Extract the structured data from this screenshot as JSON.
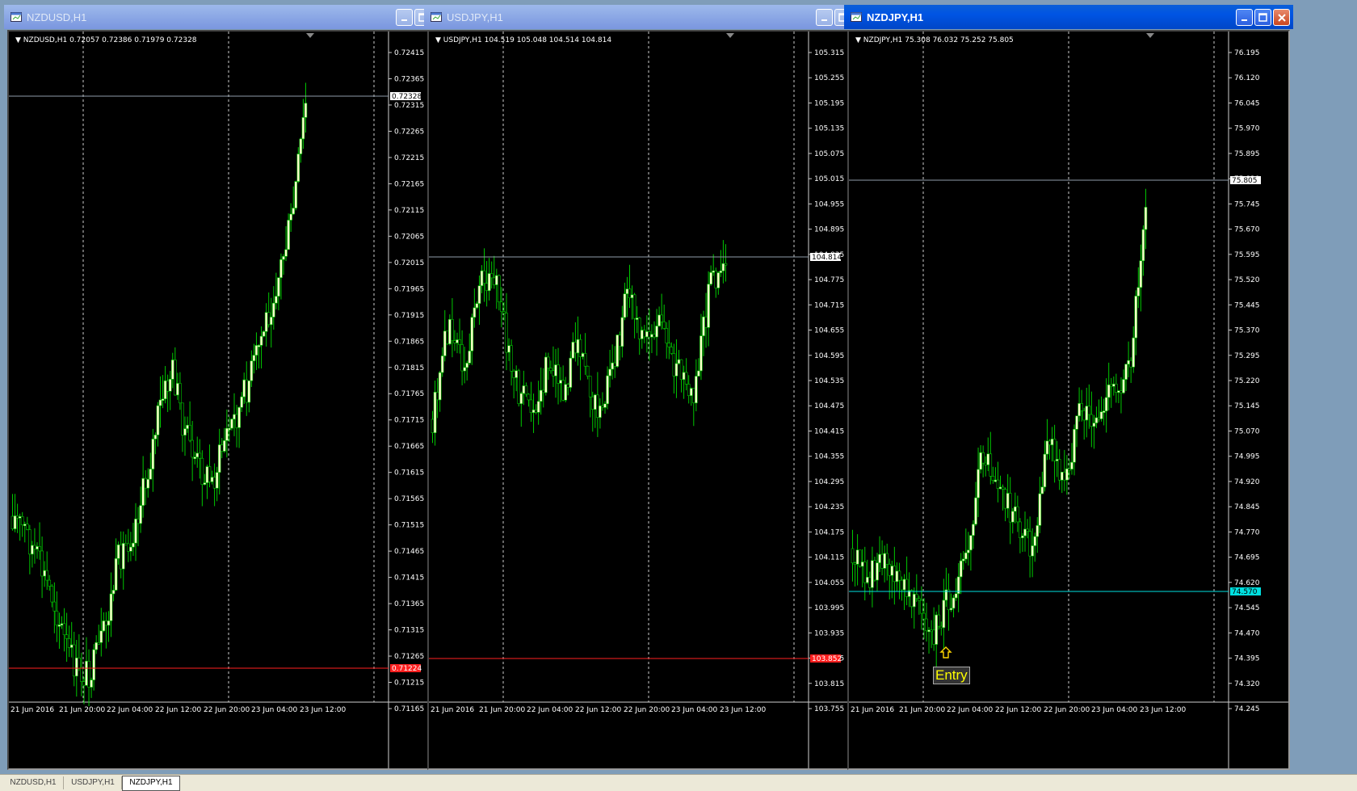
{
  "colors": {
    "candle_up": "#ffffcc",
    "candle_down": "#000000",
    "wick": "#00c800",
    "grid": "#ffffff",
    "bid_line": "#8f9caa",
    "red_line": "#ff2020",
    "cyan_line": "#00e0e0",
    "axis_text": "#ffffff"
  },
  "windows": [
    {
      "id": "nzdusd",
      "title": "NZDUSD,H1",
      "active": false,
      "info": "NZDUSD,H1  0.72057 0.72386 0.71979 0.72328",
      "price_labels": [
        "0.72415",
        "0.72365",
        "0.72315",
        "0.72265",
        "0.72215",
        "0.72165",
        "0.72115",
        "0.72065",
        "0.72015",
        "0.71965",
        "0.71915",
        "0.71865",
        "0.71815",
        "0.71765",
        "0.71715",
        "0.71665",
        "0.71615",
        "0.71565",
        "0.71515",
        "0.71465",
        "0.71415",
        "0.71365",
        "0.71315",
        "0.71265",
        "0.71215",
        "0.71165"
      ],
      "time_labels": [
        "21 Jun 2016",
        "21 Jun 20:00",
        "22 Jun 04:00",
        "22 Jun 12:00",
        "22 Jun 20:00",
        "23 Jun 04:00",
        "23 Jun 12:00"
      ],
      "bid_label": "0.72328",
      "red_label": "0.71224"
    },
    {
      "id": "usdjpy",
      "title": "USDJPY,H1",
      "active": false,
      "info": "USDJPY,H1  104.519 105.048 104.514 104.814",
      "price_labels": [
        "105.315",
        "105.255",
        "105.195",
        "105.135",
        "105.075",
        "105.015",
        "104.955",
        "104.895",
        "104.835",
        "104.775",
        "104.715",
        "104.655",
        "104.595",
        "104.535",
        "104.475",
        "104.415",
        "104.355",
        "104.295",
        "104.235",
        "104.175",
        "104.115",
        "104.055",
        "103.995",
        "103.935",
        "103.875",
        "103.815",
        "103.755"
      ],
      "time_labels": [
        "21 Jun 2016",
        "21 Jun 20:00",
        "22 Jun 04:00",
        "22 Jun 12:00",
        "22 Jun 20:00",
        "23 Jun 04:00",
        "23 Jun 12:00"
      ],
      "bid_label": "104.814",
      "red_label": "103.852"
    },
    {
      "id": "nzdjpy",
      "title": "NZDJPY,H1",
      "active": true,
      "info": "NZDJPY,H1  75.308 76.032 75.252 75.805",
      "price_labels": [
        "76.195",
        "76.120",
        "76.045",
        "75.970",
        "75.895",
        "75.820",
        "75.745",
        "75.670",
        "75.595",
        "75.520",
        "75.445",
        "75.370",
        "75.295",
        "75.220",
        "75.145",
        "75.070",
        "74.995",
        "74.920",
        "74.845",
        "74.770",
        "74.695",
        "74.620",
        "74.545",
        "74.470",
        "74.395",
        "74.320",
        "74.245"
      ],
      "time_labels": [
        "21 Jun 2016",
        "21 Jun 20:00",
        "22 Jun 04:00",
        "22 Jun 12:00",
        "22 Jun 20:00",
        "23 Jun 04:00",
        "23 Jun 12:00"
      ],
      "bid_label": "75.805",
      "cyan_label": "74.570",
      "entry_label": "Entry"
    }
  ],
  "tabs": [
    "NZDUSD,H1",
    "USDJPY,H1",
    "NZDJPY,H1"
  ],
  "active_tab": 2
}
